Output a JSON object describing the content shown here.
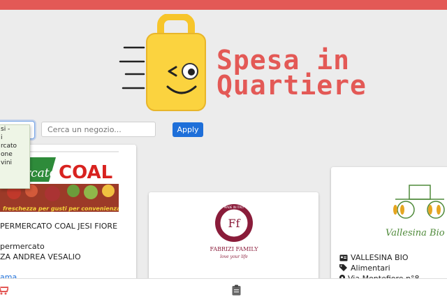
{
  "brand": {
    "line1": "Spesa in",
    "line2": "Quartiere"
  },
  "filter": {
    "dropdown_items": [
      "si -",
      "i",
      "rcato",
      "",
      "one",
      "vini"
    ],
    "search_placeholder": "Cerca un negozio...",
    "apply_label": "Apply"
  },
  "shops": [
    {
      "banner_script": "rcato",
      "banner_brand": "COAL",
      "banner_slogan": "freschezza  per  gusti  per  convenienza",
      "name": "PERMERCATO COAL JESI FIORE",
      "category": "permercato",
      "address": "ZA ANDREA VESALIO",
      "link": "ama"
    },
    {
      "logo_ring_top": "MADE IN ITALY",
      "logo_monogram": "Ff",
      "logo_name": "FABRIZI FAMILY",
      "logo_tagline": "love your life"
    },
    {
      "logo_name": "Vallesina Bio",
      "name": "VALLESINA BIO",
      "category": "Alimentari",
      "address": "Via Montefiore n°8"
    }
  ],
  "colors": {
    "brand_red": "#e35956",
    "accent_blue": "#1e6fd9",
    "bag_yellow": "#fbd33f"
  },
  "icons": {
    "cart": "cart-icon",
    "clipboard": "clipboard-icon",
    "idcard": "id-card-icon",
    "tags": "tags-icon",
    "pin": "map-pin-icon"
  }
}
